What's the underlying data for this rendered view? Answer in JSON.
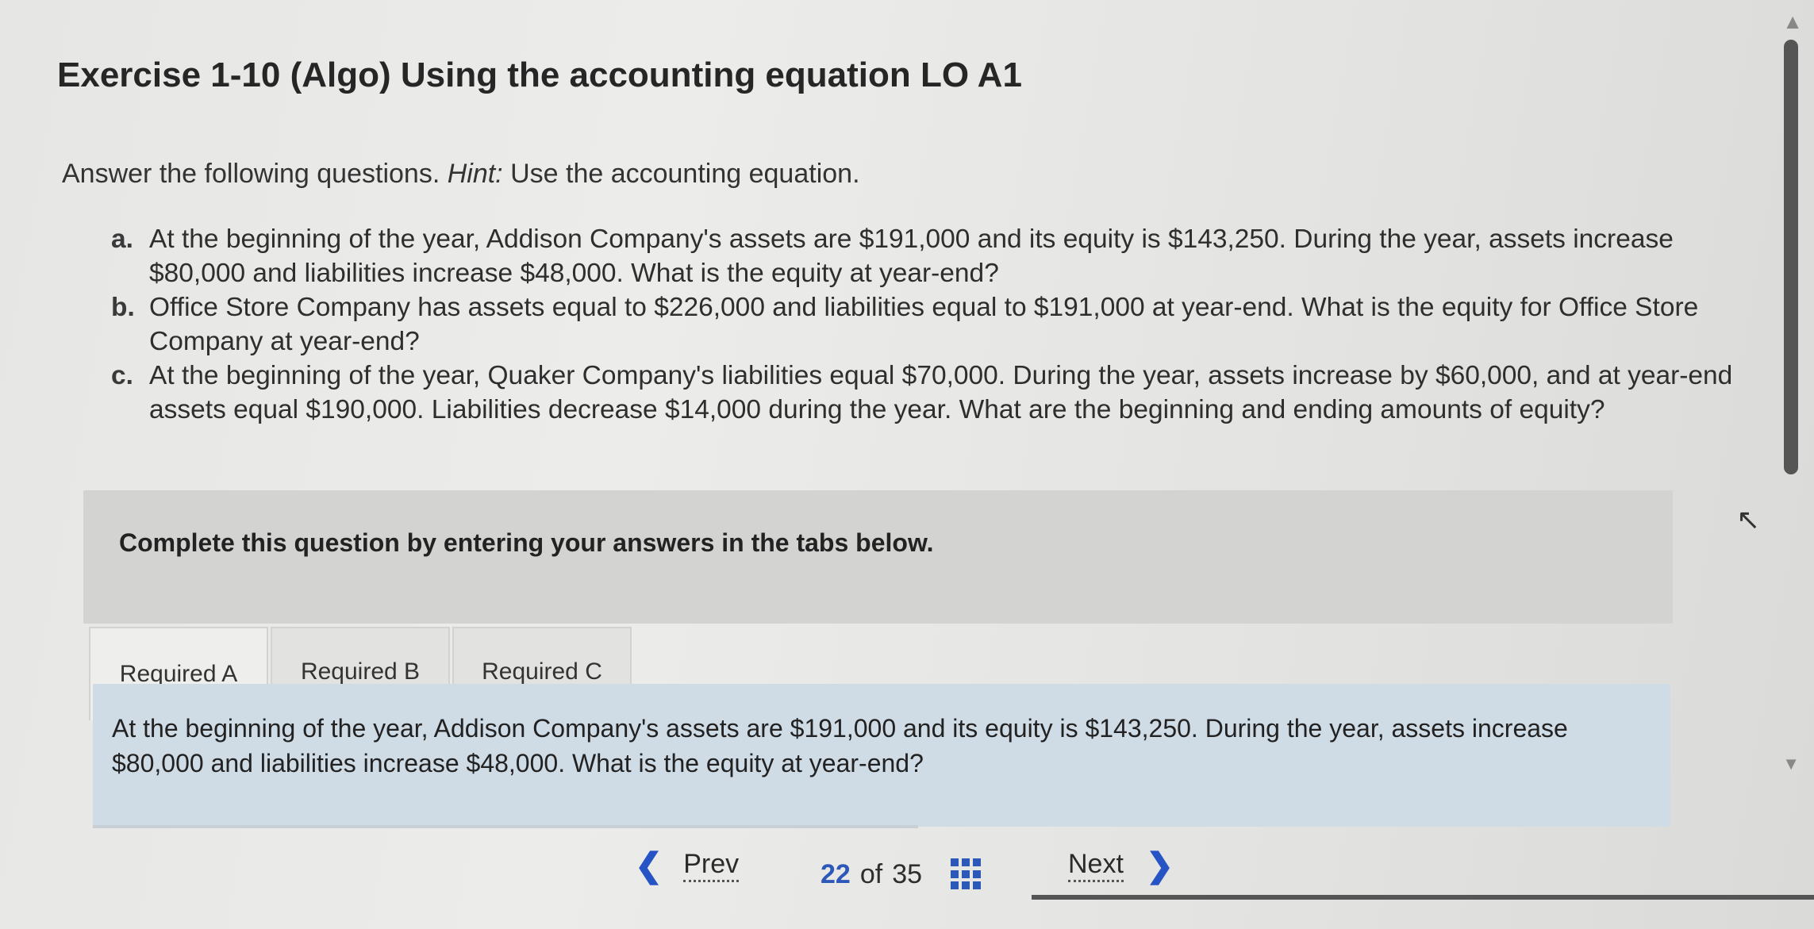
{
  "title": "Exercise 1-10 (Algo) Using the accounting equation LO A1",
  "intro": {
    "text": "Answer the following questions. ",
    "hint_label": "Hint:",
    "hint_text": " Use the accounting equation."
  },
  "questions": [
    {
      "marker": "a.",
      "text": "At the beginning of the year, Addison Company's assets are $191,000 and its equity is $143,250. During the year, assets increase $80,000 and liabilities increase $48,000. What is the equity at year-end?"
    },
    {
      "marker": "b.",
      "text": "Office Store Company has assets equal to $226,000 and liabilities equal to $191,000 at year-end. What is the equity for Office Store Company at year-end?"
    },
    {
      "marker": "c.",
      "text": "At the beginning of the year, Quaker Company's liabilities equal $70,000. During the year, assets increase by $60,000, and at year-end assets equal $190,000. Liabilities decrease $14,000 during the year. What are the beginning and ending amounts of equity?"
    }
  ],
  "instruction": "Complete this question by entering your answers in the tabs below.",
  "tabs": [
    {
      "label": "Required A"
    },
    {
      "label": "Required B"
    },
    {
      "label": "Required C"
    }
  ],
  "active_tab": "Required A",
  "panel_text": "At the beginning of the year, Addison Company's assets are $191,000 and its equity is $143,250. During the year, assets increase $80,000 and liabilities increase $48,000. What is the equity at year-end?",
  "nav": {
    "prev_label": "Prev",
    "next_label": "Next",
    "current_page": "22",
    "of_label": "of",
    "total_pages": "35"
  },
  "icons": {
    "prev": "chevron-left-icon",
    "next": "chevron-right-icon",
    "grid": "grid-icon"
  },
  "colors": {
    "accent": "#2c58b8",
    "panel_bg": "#cfdbe5",
    "instruction_bg": "#d3d3d1"
  }
}
